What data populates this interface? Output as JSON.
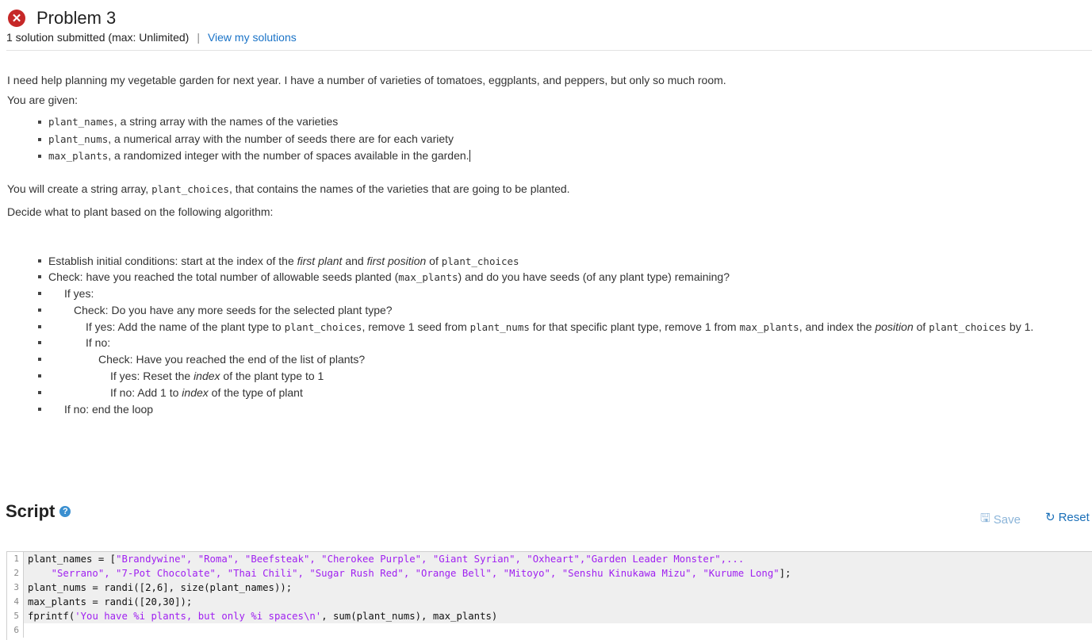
{
  "header": {
    "title": "Problem 3",
    "status_icon": "x-circle-icon",
    "submitted": "1 solution submitted (max: Unlimited)",
    "separator": "|",
    "view_link": "View my solutions"
  },
  "description": {
    "intro": "I need help planning my vegetable garden for next year. I have a number of varieties of tomatoes, eggplants, and peppers, but only so much room.",
    "given_label": "You are given:",
    "given": [
      {
        "code": "plant_names",
        "text": ", a string array with the names of the varieties"
      },
      {
        "code": "plant_nums",
        "text": ", a numerical array with the number of seeds there are for each variety"
      },
      {
        "code": "max_plants",
        "text": ", a randomized integer with the number of spaces available in the garden."
      }
    ],
    "create_pre": "You will create a string array, ",
    "create_code": "plant_choices",
    "create_post": ", that contains the names of the varieties that are going to be planted.",
    "decide": "Decide what to plant based on the following algorithm:",
    "algo": {
      "l1_a": "Establish initial conditions: start at the index of the ",
      "l1_b": "first plant",
      "l1_c": " and ",
      "l1_d": "first position",
      "l1_e": " of ",
      "l1_code": "plant_choices",
      "l2_a": "Check: have you reached the total number of allowable seeds planted (",
      "l2_code": "max_plants",
      "l2_b": ") and do you have seeds (of any plant type) remaining?",
      "l3": "If yes:",
      "l4": "Check: Do you have any more seeds for the selected plant type?",
      "l5_a": "If yes: Add the name of the plant type to ",
      "l5_code1": "plant_choices",
      "l5_b": ", remove 1 seed from ",
      "l5_code2": "plant_nums",
      "l5_c": " for that specific plant type, remove 1 from ",
      "l5_code3": "max_plants",
      "l5_d": ", and index the ",
      "l5_e": "position",
      "l5_f": " of ",
      "l5_code4": "plant_choices",
      "l5_g": " by 1.",
      "l6": "If no:",
      "l7": "Check: Have you reached the end of the list of plants?",
      "l8_a": "If yes: Reset the ",
      "l8_b": "index",
      "l8_c": " of the plant type to 1",
      "l9_a": "If no: Add 1 to ",
      "l9_b": "index",
      "l9_c": " of the type of plant",
      "l10": "If no: end the loop"
    }
  },
  "script": {
    "title": "Script",
    "help_icon": "question-circle-icon",
    "save_label": "Save",
    "save_icon": "floppy-disk-icon",
    "reset_label": "Reset",
    "reset_icon": "refresh-icon"
  },
  "code": {
    "l1_a": "plant_names = [",
    "l1_s": "\"Brandywine\", \"Roma\", \"Beefsteak\", \"Cherokee Purple\", \"Giant Syrian\", \"Oxheart\",\"Garden Leader Monster\",...",
    "l2_s": "    \"Serrano\", \"7-Pot Chocolate\", \"Thai Chili\", \"Sugar Rush Red\", \"Orange Bell\", \"Mitoyo\", \"Senshu Kinukawa Mizu\", \"Kurume Long\"",
    "l2_b": "];",
    "l3": "plant_nums = randi([2,6], size(plant_names));",
    "l4": "max_plants = randi([20,30]);",
    "l5_a": "fprintf(",
    "l5_s": "'You have %i plants, but only %i spaces\\n'",
    "l5_b": ", sum(plant_nums), max_plants)",
    "line_numbers": [
      "1",
      "2",
      "3",
      "4",
      "5",
      "6"
    ]
  }
}
